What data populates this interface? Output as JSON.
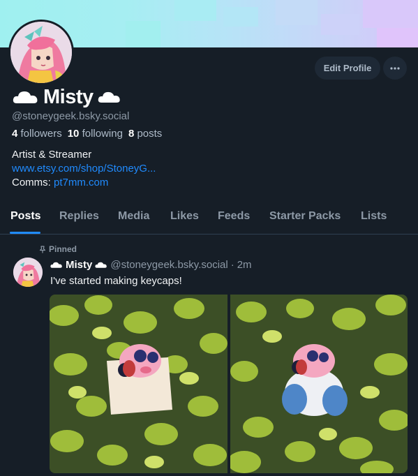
{
  "profile": {
    "display_name": "Misty",
    "handle": "@stoneygeek.bsky.social",
    "followers_count": "4",
    "followers_label": "followers",
    "following_count": "10",
    "following_label": "following",
    "posts_count": "8",
    "posts_label": "posts",
    "bio_line1": "Artist & Streamer",
    "bio_link": "www.etsy.com/shop/StoneyG...",
    "bio_comms_label": "Comms:",
    "bio_comms_link": "pt7mm.com"
  },
  "actions": {
    "edit_profile": "Edit Profile",
    "more_icon": "ellipsis-icon"
  },
  "tabs": [
    {
      "label": "Posts",
      "active": true
    },
    {
      "label": "Replies",
      "active": false
    },
    {
      "label": "Media",
      "active": false
    },
    {
      "label": "Likes",
      "active": false
    },
    {
      "label": "Feeds",
      "active": false
    },
    {
      "label": "Starter Packs",
      "active": false
    },
    {
      "label": "Lists",
      "active": false
    }
  ],
  "post": {
    "pinned_label": "Pinned",
    "author_name": "Misty",
    "author_handle": "@stoneygeek.bsky.social",
    "separator": "·",
    "time": "2m",
    "text": "I've started making keycaps!"
  },
  "colors": {
    "background": "#161e27",
    "accent": "#208bfe",
    "muted": "#8d99a6",
    "button_bg": "#1e2936"
  }
}
